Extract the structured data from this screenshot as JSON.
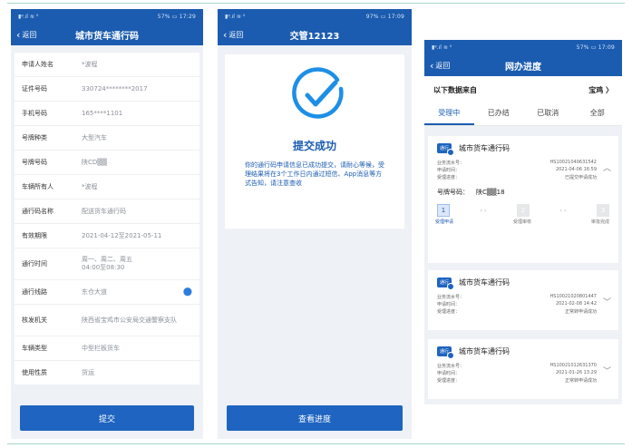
{
  "screens": {
    "apply": {
      "status_left": "▮ᵍ.ıl ≋ ⁰",
      "status_right": "57% ▭ 17:29",
      "back_label": "返回",
      "title": "城市货车通行码",
      "fields": [
        {
          "label": "申请人姓名",
          "value": "*波程"
        },
        {
          "label": "证件号码",
          "value": "330724********2017"
        },
        {
          "label": "手机号码",
          "value": "165****1101"
        },
        {
          "label": "号牌种类",
          "value": "大型汽车"
        },
        {
          "label": "号牌号码",
          "value": "陕CD▒▒"
        },
        {
          "label": "车辆所有人",
          "value": "*波程"
        },
        {
          "label": "通行码名称",
          "value": "配送货车通行码"
        },
        {
          "label": "有效期限",
          "value": "2021-04-12至2021-05-11"
        },
        {
          "label": "通行时间",
          "value": "周一、周二、周五\n04:00至08:30"
        },
        {
          "label": "通行线路",
          "value": "东仓大道"
        },
        {
          "label": "核发机关",
          "value": "陕西省宝鸡市公安局交通警察支队"
        },
        {
          "label": "车辆类型",
          "value": "中型栏板货车"
        },
        {
          "label": "使用性质",
          "value": "货运"
        }
      ],
      "submit_label": "提交"
    },
    "success": {
      "status_left": "▮ᵍ.ıl ≋ ⁰",
      "status_right": "97% ▭ 17:09",
      "back_label": "返回",
      "title": "交管12123",
      "result_title": "提交成功",
      "result_desc": "你的通行码申请信息已成功提交，请耐心等候，受理结果将在3个工作日内通过短信、App消息等方式告知，请注意查收",
      "button_label": "查看进度"
    },
    "progress": {
      "status_left": "▮ᵍ.ıl ≋ ⁰",
      "status_right": "57% ▭ 17:09",
      "back_label": "返回",
      "title": "网办进度",
      "source_label": "以下数据来自",
      "source_value": "宝鸡 〉",
      "tabs": [
        "受理中",
        "已办结",
        "已取消",
        "全部"
      ],
      "cards": [
        {
          "title": "城市货车通行码",
          "badge": "通行",
          "rows": [
            {
              "k": "业务流水号：",
              "v": "HS10021040631542"
            },
            {
              "k": "申请时间：",
              "v": "2021-04-06 16:59"
            },
            {
              "k": "受理进度：",
              "v": "已提交申请成功"
            }
          ],
          "plate_label": "号牌号码：",
          "plate_value": "陕C▒▒18",
          "steps": [
            "1",
            "2",
            "3"
          ],
          "step_labels": [
            "受理申请",
            "受理审核",
            "审批完成"
          ]
        },
        {
          "title": "城市货车通行码",
          "badge": "通行",
          "rows": [
            {
              "k": "业务流水号：",
              "v": "HS10021020801447"
            },
            {
              "k": "申请时间：",
              "v": "2021-02-08 14:42"
            },
            {
              "k": "受理进度：",
              "v": "正常转申请成功"
            }
          ]
        },
        {
          "title": "城市货车通行码",
          "badge": "通行",
          "rows": [
            {
              "k": "业务流水号：",
              "v": "HS10021012631370"
            },
            {
              "k": "申请时间：",
              "v": "2021-01-26 13:29"
            },
            {
              "k": "受理进度：",
              "v": "正常转申请成功"
            }
          ]
        }
      ]
    }
  }
}
